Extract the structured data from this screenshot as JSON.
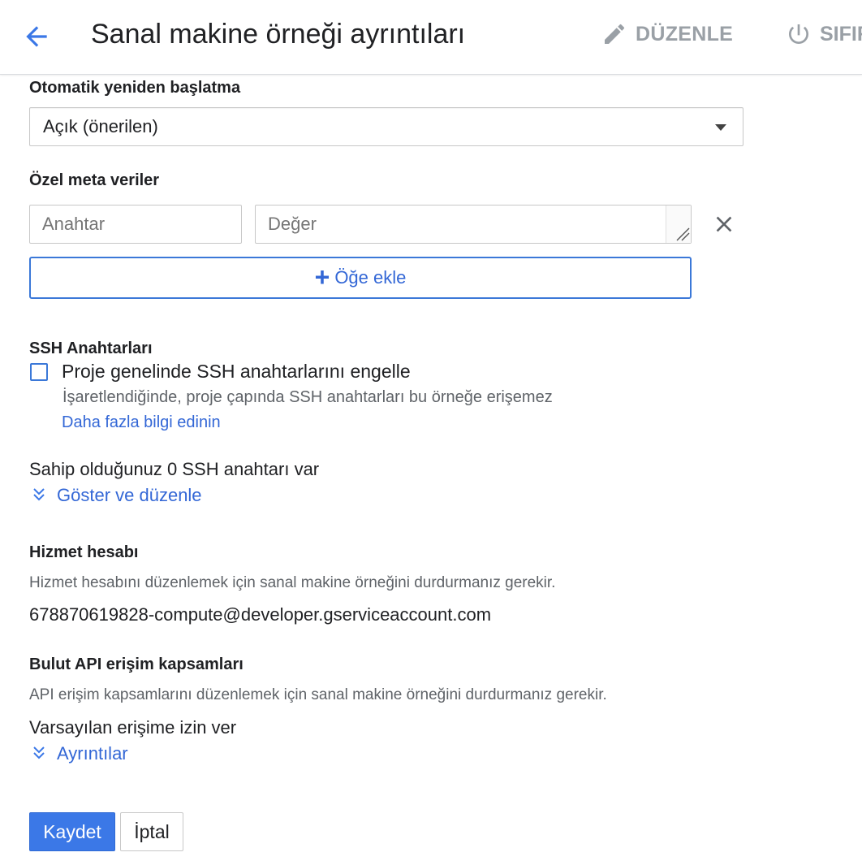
{
  "header": {
    "title": "Sanal makine örneği ayrıntıları",
    "edit_label": "DÜZENLE",
    "reset_label": "SIFIR"
  },
  "auto_restart": {
    "label": "Otomatik yeniden başlatma",
    "selected": "Açık (önerilen)"
  },
  "metadata": {
    "label": "Özel meta veriler",
    "key_placeholder": "Anahtar",
    "value_placeholder": "Değer",
    "add_item_label": "Öğe ekle"
  },
  "ssh": {
    "section_label": "SSH Anahtarları",
    "block_checkbox_label": "Proje genelinde SSH anahtarlarını engelle",
    "block_checked": false,
    "block_description": "İşaretlendiğinde, proje çapında SSH anahtarları bu örneğe erişemez",
    "learn_more": "Daha fazla bilgi edinin",
    "key_count_text": "Sahip olduğunuz 0 SSH anahtarı var",
    "show_edit": "Göster ve düzenle"
  },
  "service_account": {
    "label": "Hizmet hesabı",
    "note": "Hizmet hesabını düzenlemek için sanal makine örneğini durdurmanız gerekir.",
    "value": "678870619828-compute@developer.gserviceaccount.com"
  },
  "api_scopes": {
    "label": "Bulut API erişim kapsamları",
    "note": "API erişim kapsamlarını düzenlemek için sanal makine örneğini durdurmanız gerekir.",
    "value": "Varsayılan erişime izin ver",
    "details": "Ayrıntılar"
  },
  "footer": {
    "save_label": "Kaydet",
    "cancel_label": "İptal"
  },
  "colors": {
    "accent": "#3367d6",
    "primary_button": "#3b78e7",
    "disabled_text": "#9aa0a6"
  }
}
